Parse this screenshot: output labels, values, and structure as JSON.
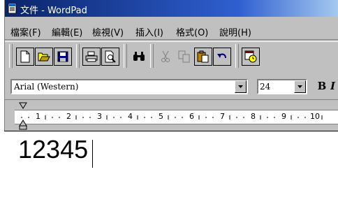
{
  "window": {
    "title": "文件 - WordPad"
  },
  "menu": {
    "items": [
      "檔案(F)",
      "編輯(E)",
      "檢視(V)",
      "插入(I)",
      "格式(O)",
      "說明(H)"
    ]
  },
  "toolbar": {
    "buttons": [
      "new-icon",
      "open-icon",
      "save-icon",
      "print-icon",
      "print-preview-icon",
      "find-icon",
      "cut-icon",
      "copy-icon",
      "paste-icon",
      "undo-icon",
      "insert-datetime-icon"
    ]
  },
  "format": {
    "font": "Arial (Western)",
    "size": "24",
    "bold_label": "B",
    "italic_label": "I"
  },
  "ruler": {
    "numbers": [
      "1",
      "2",
      "3",
      "4",
      "5",
      "6",
      "7",
      "8",
      "9",
      "10"
    ]
  },
  "document": {
    "text": "12345"
  }
}
